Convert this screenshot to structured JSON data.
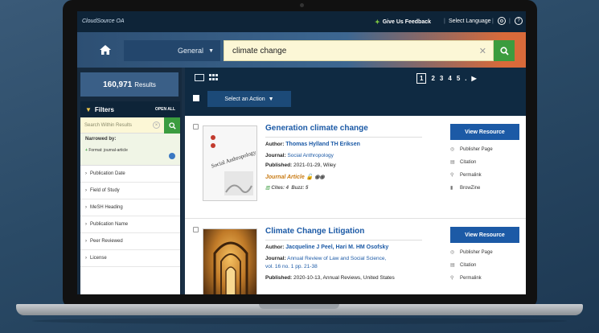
{
  "topbar": {
    "logo": "CloudSource OA",
    "feedback": "Give Us Feedback",
    "language": "Select Language",
    "help_icon": "question-icon",
    "settings_icon": "gear-icon"
  },
  "search": {
    "scope": "General",
    "query": "climate change"
  },
  "results_count": {
    "value": "160,971",
    "label": "Results"
  },
  "filters": {
    "title": "Filters",
    "open_all": "OPEN ALL",
    "search_placeholder": "Search Within Results",
    "narrowed_by": "Narrowed by:",
    "active_filter": "Format: journal-article",
    "items": [
      "Publication Date",
      "Field of Study",
      "MeSH Heading",
      "Publication Name",
      "Peer Reviewed",
      "License"
    ]
  },
  "toolbar": {
    "action_label": "Select an Action",
    "pages": [
      "1",
      "2",
      "3",
      "4",
      "5",
      "."
    ]
  },
  "results": [
    {
      "title": "Generation climate change",
      "author_label": "Author:",
      "author": "Thomas Hylland TH Eriksen",
      "journal_label": "Journal:",
      "journal": "Social Anthropology",
      "published_label": "Published:",
      "published": "2021-01-29, Wiley",
      "type": "Journal Article",
      "cites": "Cites: 4",
      "buzz": "Buzz: 5",
      "view_label": "View Resource",
      "actions": [
        "Publisher Page",
        "Citation",
        "Permalink",
        "BrowZine"
      ]
    },
    {
      "title": "Climate Change Litigation",
      "author_label": "Author:",
      "author": "Jacqueline J Peel, Hari M. HM Osofsky",
      "journal_label": "Journal:",
      "journal": "Annual Review of Law and Social Science,",
      "journal_line2": "vol. 16 no. 1 pp. 21-38",
      "published_label": "Published:",
      "published": "2020-10-13, Annual Reviews, United States",
      "view_label": "View Resource",
      "actions": [
        "Publisher Page",
        "Citation",
        "Permalink"
      ]
    }
  ]
}
